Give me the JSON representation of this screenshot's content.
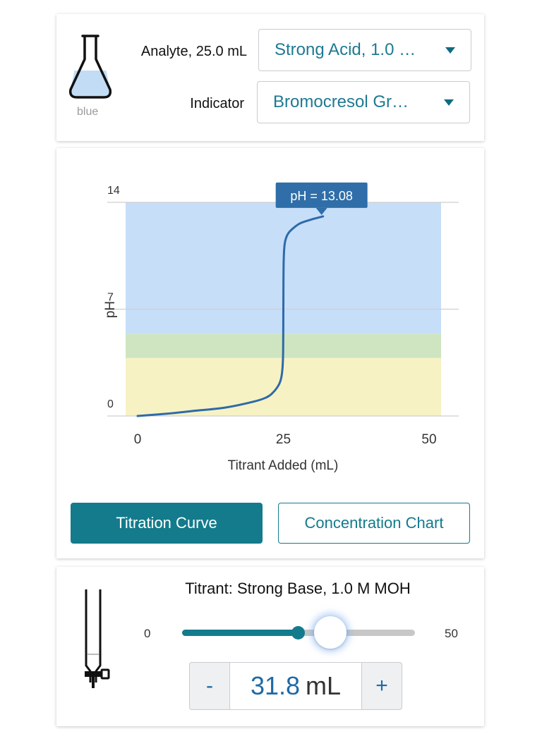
{
  "analyte": {
    "label": "Analyte, 25.0 mL",
    "selected": "Strong Acid, 1.0 …",
    "flask_color_label": "blue",
    "flask_fill_color": "#c2dcf5"
  },
  "indicator": {
    "label": "Indicator",
    "selected": "Bromocresol Gr…"
  },
  "chart_data": {
    "type": "line",
    "xlabel": "Titrant Added (mL)",
    "ylabel": "pH",
    "xlim": [
      0,
      50
    ],
    "ylim": [
      0,
      14
    ],
    "x_ticks": [
      "0",
      "25",
      "50"
    ],
    "y_ticks": [
      "0",
      "7",
      "14"
    ],
    "tooltip": "pH = 13.08",
    "indicator_bands": [
      {
        "from": 0,
        "to": 3.8,
        "color": "#f7f2c4"
      },
      {
        "from": 3.8,
        "to": 5.4,
        "color": "#cfe5c2"
      },
      {
        "from": 5.4,
        "to": 14,
        "color": "#c6def8"
      }
    ],
    "series": [
      {
        "color": "#2e6aa9",
        "x": [
          0,
          5,
          10,
          15,
          20,
          22,
          23,
          24,
          24.5,
          24.8,
          24.95,
          25,
          25.05,
          25.2,
          25.5,
          26,
          27,
          28,
          30,
          31.8
        ],
        "y": [
          0.0,
          0.15,
          0.35,
          0.55,
          0.95,
          1.2,
          1.45,
          1.9,
          2.3,
          2.9,
          4.0,
          7.0,
          10.0,
          11.2,
          11.7,
          12.05,
          12.4,
          12.65,
          12.9,
          13.08
        ]
      }
    ]
  },
  "graph_buttons": {
    "curve": "Titration Curve",
    "concentration": "Concentration Chart"
  },
  "titrant": {
    "title": "Titrant: Strong Base, 1.0 M MOH",
    "slider_min": "0",
    "slider_max": "50",
    "volume": 31.8,
    "volume_text": "31.8",
    "unit": "mL",
    "snap_point": 25,
    "minus": "-",
    "plus": "+"
  }
}
